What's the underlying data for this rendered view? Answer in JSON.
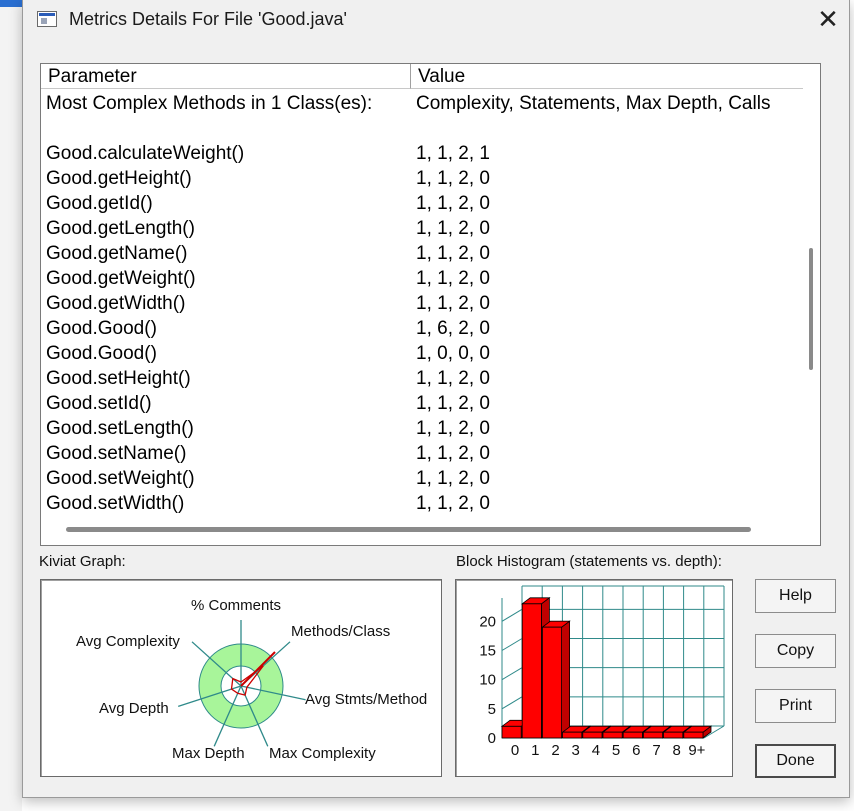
{
  "window": {
    "title": "Metrics Details For File 'Good.java'",
    "close_glyph": "✕"
  },
  "table": {
    "columns": [
      "Parameter",
      "Value"
    ],
    "rows": [
      [
        "Most Complex Methods in 1 Class(es):",
        "Complexity, Statements, Max Depth, Calls"
      ],
      [
        "",
        ""
      ],
      [
        "Good.calculateWeight()",
        "1, 1, 2, 1"
      ],
      [
        "Good.getHeight()",
        "1, 1, 2, 0"
      ],
      [
        "Good.getId()",
        "1, 1, 2, 0"
      ],
      [
        "Good.getLength()",
        "1, 1, 2, 0"
      ],
      [
        "Good.getName()",
        "1, 1, 2, 0"
      ],
      [
        "Good.getWeight()",
        "1, 1, 2, 0"
      ],
      [
        "Good.getWidth()",
        "1, 1, 2, 0"
      ],
      [
        "Good.Good()",
        "1, 6, 2, 0"
      ],
      [
        "Good.Good()",
        "1, 0, 0, 0"
      ],
      [
        "Good.setHeight()",
        "1, 1, 2, 0"
      ],
      [
        "Good.setId()",
        "1, 1, 2, 0"
      ],
      [
        "Good.setLength()",
        "1, 1, 2, 0"
      ],
      [
        "Good.setName()",
        "1, 1, 2, 0"
      ],
      [
        "Good.setWeight()",
        "1, 1, 2, 0"
      ],
      [
        "Good.setWidth()",
        "1, 1, 2, 0"
      ]
    ]
  },
  "kiviat": {
    "label": "Kiviat Graph:",
    "axes": [
      "% Comments",
      "Methods/Class",
      "Avg Stmts/Method",
      "Max Complexity",
      "Max Depth",
      "Avg Depth",
      "Avg Complexity"
    ],
    "colors": {
      "band": "#a8f59a",
      "axis": "#2f8a8a",
      "profile": "#cc0000"
    }
  },
  "histogram": {
    "label": "Block Histogram (statements vs. depth):",
    "color": "#ff0000",
    "grid_color": "#2f8a8a"
  },
  "chart_data": {
    "type": "bar",
    "categories": [
      "0",
      "1",
      "2",
      "3",
      "4",
      "5",
      "6",
      "7",
      "8",
      "9+"
    ],
    "values": [
      2,
      23,
      19,
      1,
      1,
      1,
      1,
      1,
      1,
      1
    ],
    "ylim": [
      0,
      24
    ],
    "yticks": [
      0,
      5,
      10,
      15,
      20
    ],
    "grid": true
  },
  "buttons": {
    "help": "Help",
    "copy": "Copy",
    "print": "Print",
    "done": "Done"
  }
}
